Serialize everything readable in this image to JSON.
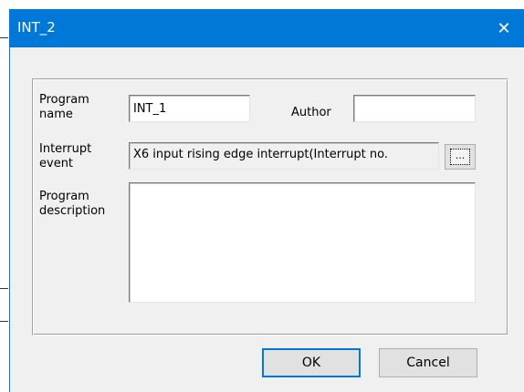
{
  "window": {
    "title": "INT_2",
    "close_glyph": "✕"
  },
  "form": {
    "program_name_label": "Program name",
    "program_name_value": "INT_1",
    "author_label": "Author",
    "author_value": "",
    "interrupt_event_label": "Interrupt event",
    "interrupt_event_value": "X6 input rising edge interrupt(Interrupt no.",
    "browse_label": "...",
    "description_label": "Program description",
    "description_value": ""
  },
  "buttons": {
    "ok": "OK",
    "cancel": "Cancel"
  },
  "colors": {
    "titlebar": "#0078d7",
    "dialog_bg": "#f0f0f0"
  }
}
